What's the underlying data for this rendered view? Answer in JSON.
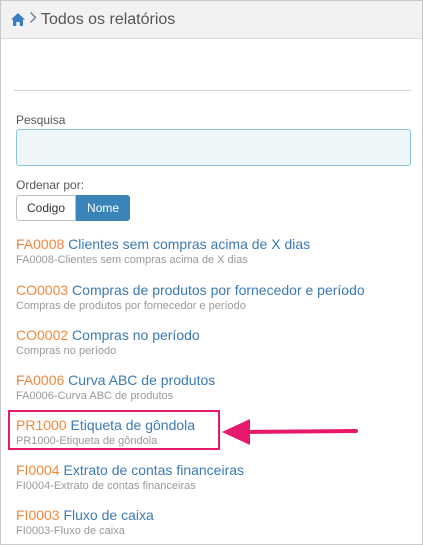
{
  "header": {
    "title": "Todos os relatórios"
  },
  "search": {
    "label": "Pesquisa",
    "value": "",
    "placeholder": ""
  },
  "order": {
    "label": "Ordenar por:",
    "options": [
      "Codigo",
      "Nome"
    ],
    "selected": "Nome"
  },
  "reports": [
    {
      "code": "FA0008",
      "name": "Clientes sem compras acima de X dias",
      "subtitle": "FA0008-Clientes sem compras acima de X dias"
    },
    {
      "code": "CO0003",
      "name": "Compras de produtos por fornecedor e período",
      "subtitle": "Compras de produtos por fornecedor e período"
    },
    {
      "code": "CO0002",
      "name": "Compras no período",
      "subtitle": "Compras no período"
    },
    {
      "code": "FA0006",
      "name": "Curva ABC de produtos",
      "subtitle": "FA0006-Curva ABC de produtos"
    },
    {
      "code": "PR1000",
      "name": "Etiqueta de gôndola",
      "subtitle": "PR1000-Etiqueta de gôndola"
    },
    {
      "code": "FI0004",
      "name": "Extrato de contas financeiras",
      "subtitle": "FI0004-Extrato de contas financeiras"
    },
    {
      "code": "FI0003",
      "name": "Fluxo de caixa",
      "subtitle": "FI0003-Fluxo de caixa"
    }
  ],
  "colors": {
    "code": "#f0883b",
    "name": "#3b7ab3",
    "accent": "#3a84b9",
    "highlight": "#e8196a"
  },
  "icons": {
    "home": "home-icon",
    "separator": "chevron-right-icon"
  }
}
